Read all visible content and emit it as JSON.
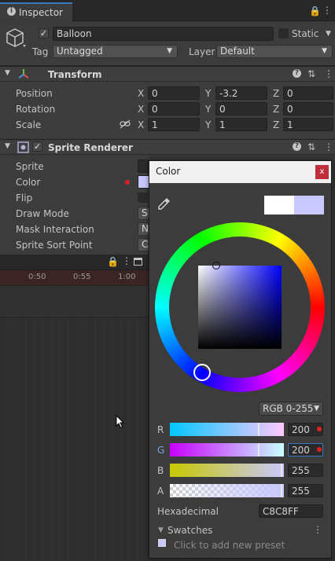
{
  "tab": {
    "title": "Inspector",
    "icon": "info-icon"
  },
  "object": {
    "name": "Balloon",
    "active": true,
    "static_label": "Static",
    "tag_label": "Tag",
    "tag_value": "Untagged",
    "layer_label": "Layer",
    "layer_value": "Default"
  },
  "transform": {
    "title": "Transform",
    "rows": [
      {
        "label": "Position",
        "x": "0",
        "y": "-3.2",
        "z": "0"
      },
      {
        "label": "Rotation",
        "x": "0",
        "y": "0",
        "z": "0"
      },
      {
        "label": "Scale",
        "x": "1",
        "y": "1",
        "z": "1"
      }
    ],
    "axes": [
      "X",
      "Y",
      "Z"
    ]
  },
  "sprite_renderer": {
    "title": "Sprite Renderer",
    "rows": [
      "Sprite",
      "Color",
      "Flip",
      "Draw Mode",
      "Mask Interaction",
      "Sprite Sort Point"
    ],
    "draw_mode_value": "Si",
    "mask_value": "No",
    "sort_value": "Ce"
  },
  "timeline": {
    "ticks": [
      "0:50",
      "0:55",
      "1:00"
    ]
  },
  "color_picker": {
    "title": "Color",
    "close_label": "x",
    "swatch_old": "#FFFFFF",
    "swatch_new": "#C8C8FF",
    "mode": "RGB 0-255",
    "channels": [
      {
        "name": "R",
        "value": "200",
        "fraction": 0.784
      },
      {
        "name": "G",
        "value": "200",
        "fraction": 0.784
      },
      {
        "name": "B",
        "value": "255",
        "fraction": 1.0
      },
      {
        "name": "A",
        "value": "255",
        "fraction": 1.0
      }
    ],
    "hex_label": "Hexadecimal",
    "hex_value": "C8C8FF",
    "swatches_label": "Swatches",
    "add_preset_label": "Click to add new preset"
  },
  "colors": {
    "accent_red": "#e02020",
    "close_bg": "#c0303a",
    "picker_bg": "#3c3c3c"
  }
}
